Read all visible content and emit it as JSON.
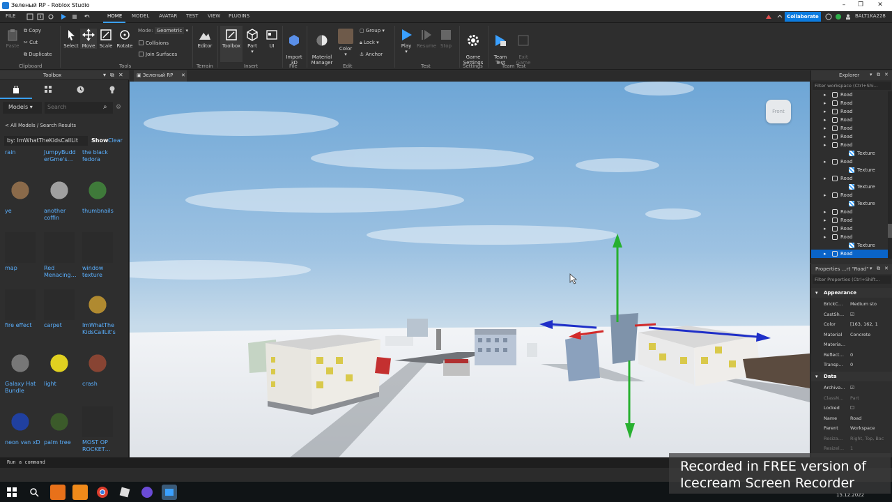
{
  "window": {
    "title": "Зеленый RP - Roblox Studio"
  },
  "menu": {
    "items": [
      "FILE",
      "HOME",
      "MODEL",
      "AVATAR",
      "TEST",
      "VIEW",
      "PLUGINS"
    ],
    "active": "HOME",
    "collaborate": "Collaborate",
    "user": "BALT1KA228"
  },
  "ribbon": {
    "clipboard": {
      "paste": "Paste",
      "copy": "Copy",
      "cut": "Cut",
      "duplicate": "Duplicate",
      "group": "Clipboard"
    },
    "tools": {
      "select": "Select",
      "move": "Move",
      "scale": "Scale",
      "rotate": "Rotate",
      "mode_label": "Mode:",
      "mode_value": "Geometric",
      "collisions": "Collisions",
      "join": "Join Surfaces",
      "group": "Tools"
    },
    "terrain": {
      "editor": "Editor",
      "group": "Terrain"
    },
    "insert": {
      "toolbox": "Toolbox",
      "part": "Part",
      "ui": "UI",
      "group": "Insert"
    },
    "file": {
      "import": "Import\n3D",
      "group": "File"
    },
    "edit": {
      "material": "Material\nManager",
      "color": "Color",
      "group_btn": "Group",
      "lock": "Lock",
      "anchor": "Anchor",
      "group": "Edit"
    },
    "test": {
      "play": "Play",
      "resume": "Resume",
      "stop": "Stop",
      "group": "Test"
    },
    "settings": {
      "game": "Game\nSettings",
      "group": "Settings"
    },
    "teamtest": {
      "team": "Team\nTest",
      "exit": "Exit\nGame",
      "group": "Team Test"
    }
  },
  "toolbox": {
    "title": "Toolbox",
    "category": "Models",
    "search_placeholder": "Search",
    "breadcrumb": "< All Models / Search Results",
    "creator_filter": "by: ImWhatTheKidsCallLit",
    "show": "Show",
    "clear": "Clear",
    "assets": [
      [
        "rain",
        "JumpyBudd\nerGme's…",
        "the black\nfedora"
      ],
      [
        "ye",
        "another\ncoffin",
        "thumbnails"
      ],
      [
        "map",
        "Red\nMenacing…",
        "window\ntexture"
      ],
      [
        "fire effect",
        "carpet",
        "ImWhatThe\nKidsCallLit's"
      ],
      [
        "Galaxy Hat\nBundle",
        "light",
        "crash"
      ],
      [
        "neon van xD",
        "palm tree",
        "MOST OP\nROCKET…"
      ]
    ]
  },
  "viewport": {
    "tab": "Зеленый RP",
    "view_cube": "Front"
  },
  "explorer": {
    "title": "Explorer",
    "filter": "Filter workspace (Ctrl+Shi...",
    "rows": [
      {
        "label": "Road",
        "indent": 1
      },
      {
        "label": "Road",
        "indent": 1
      },
      {
        "label": "Road",
        "indent": 1
      },
      {
        "label": "Road",
        "indent": 1
      },
      {
        "label": "Road",
        "indent": 1
      },
      {
        "label": "Road",
        "indent": 1
      },
      {
        "label": "Road",
        "indent": 1
      },
      {
        "label": "Texture",
        "indent": 2
      },
      {
        "label": "Road",
        "indent": 1
      },
      {
        "label": "Texture",
        "indent": 2
      },
      {
        "label": "Road",
        "indent": 1
      },
      {
        "label": "Texture",
        "indent": 2
      },
      {
        "label": "Road",
        "indent": 1
      },
      {
        "label": "Texture",
        "indent": 2
      },
      {
        "label": "Road",
        "indent": 1
      },
      {
        "label": "Road",
        "indent": 1
      },
      {
        "label": "Road",
        "indent": 1
      },
      {
        "label": "Road",
        "indent": 1
      },
      {
        "label": "Texture",
        "indent": 2
      },
      {
        "label": "Road",
        "indent": 1,
        "selected": true
      }
    ]
  },
  "properties": {
    "title": "Properties …rt \"Road\"",
    "filter": "Filter Properties (Ctrl+Shift…",
    "appearance_label": "Appearance",
    "data_label": "Data",
    "appearance": [
      {
        "k": "BrickC…",
        "v": "Medium sto"
      },
      {
        "k": "CastSh…",
        "v": "☑"
      },
      {
        "k": "Color",
        "v": "[163, 162, 1"
      },
      {
        "k": "Material",
        "v": "Concrete"
      },
      {
        "k": "Materia…",
        "v": ""
      },
      {
        "k": "Reflect…",
        "v": "0"
      },
      {
        "k": "Transp…",
        "v": "0"
      }
    ],
    "data": [
      {
        "k": "Archiva…",
        "v": "☑"
      },
      {
        "k": "ClassN…",
        "v": "Part"
      },
      {
        "k": "Locked",
        "v": "☐"
      },
      {
        "k": "Name",
        "v": "Road"
      },
      {
        "k": "Parent",
        "v": "Workspace"
      },
      {
        "k": "Resiza…",
        "v": "Right, Top, Bac"
      },
      {
        "k": "Resizel…",
        "v": "1"
      }
    ]
  },
  "command": {
    "placeholder": "Run a command"
  },
  "taskbar": {
    "date": "15.12.2022"
  },
  "watermark": {
    "line1": "Recorded in FREE version of",
    "line2": "Icecream Screen Recorder"
  },
  "colors": {
    "accent": "#3aa0ff",
    "selection": "#0a64c8",
    "panel": "#2e2e2e",
    "sky_top": "#6ea6d6",
    "snow": "#e9edf1"
  }
}
